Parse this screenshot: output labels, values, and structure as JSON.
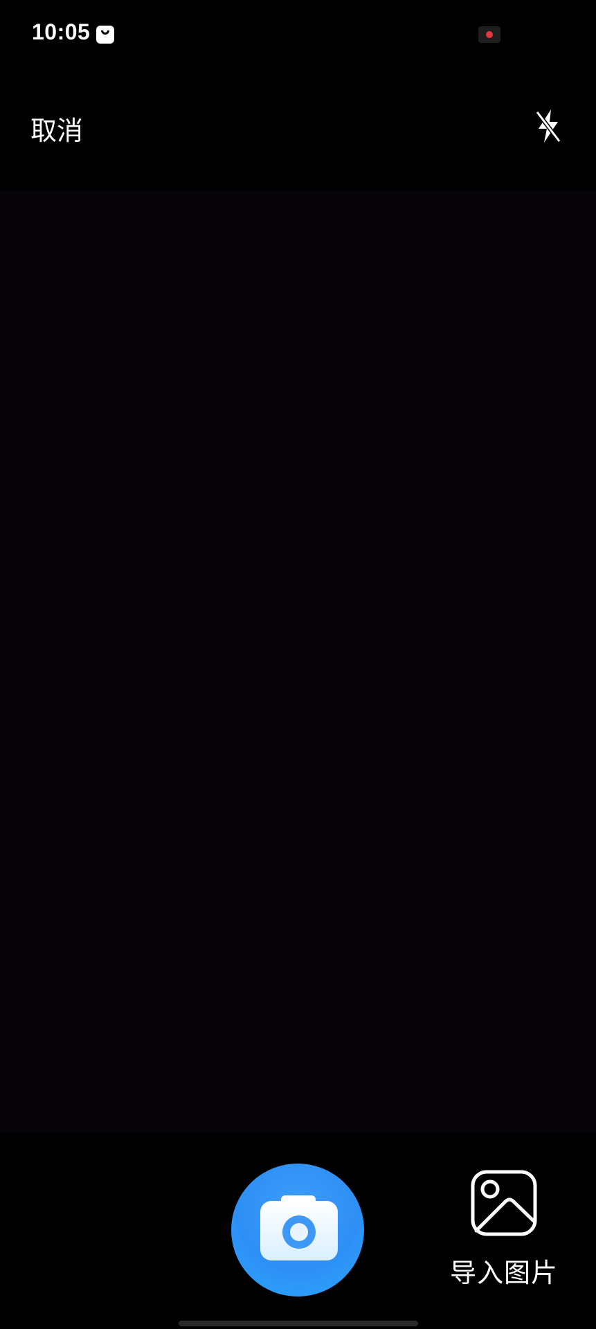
{
  "status_bar": {
    "time": "10:05",
    "icons": [
      "notification-bag-icon",
      "screen-record-icon"
    ],
    "record_color": "#e0383e"
  },
  "top_bar": {
    "cancel_label": "取消",
    "flash_icon": "flash-off-icon"
  },
  "viewfinder": {
    "background": "#060408"
  },
  "bottom_bar": {
    "shutter_icon": "camera-icon",
    "shutter_color": "#2e8ff5",
    "import_icon": "image-icon",
    "import_label": "导入图片"
  }
}
